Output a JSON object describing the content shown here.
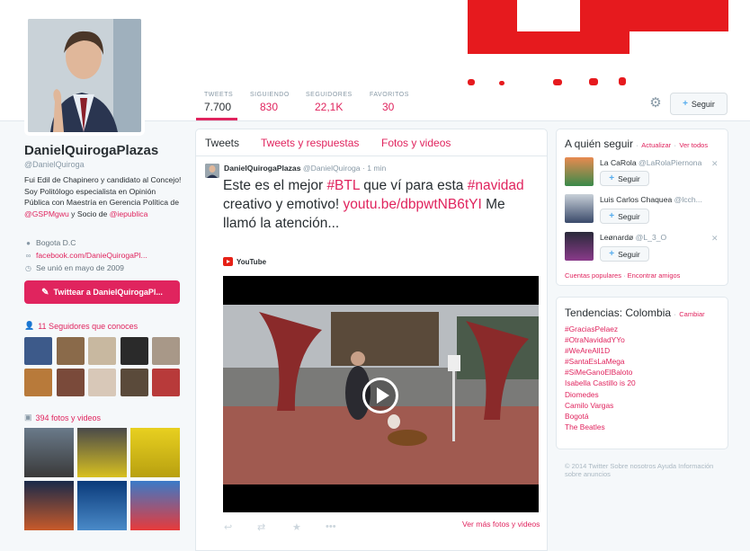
{
  "profile": {
    "name": "DanielQuirogaPlazas",
    "handle": "@DanielQuiroga",
    "bio_part1": "Fui Edil de Chapinero y candidato al Concejo! Soy Politólogo especialista en Opinión Pública con Maestría en Gerencia Política de ",
    "bio_mention1": "@GSPMgwu",
    "bio_part2": " y Socio de ",
    "bio_mention2": "@iepublica",
    "location": "Bogota D.C",
    "website": "facebook.com/DanieQuirogaPl...",
    "joined": "Se unió en mayo de 2009",
    "tweet_to_label": "Twittear a DanielQuirogaPl...",
    "followers_you_know": "11 Seguidores que conoces",
    "photos_videos": "394 fotos y videos"
  },
  "stats": [
    {
      "label": "TWEETS",
      "value": "7.700"
    },
    {
      "label": "SIGUIENDO",
      "value": "830"
    },
    {
      "label": "SEGUIDORES",
      "value": "22,1K"
    },
    {
      "label": "FAVORITOS",
      "value": "30"
    }
  ],
  "header": {
    "follow_label": "Seguir"
  },
  "timeline": {
    "tabs": [
      "Tweets",
      "Tweets y respuestas",
      "Fotos y videos"
    ],
    "tweet": {
      "name": "DanielQuirogaPlazas",
      "handle": "@DanielQuiroga",
      "separator": "·",
      "time": "1 min",
      "text_part1": "Este es el mejor ",
      "hashtag1": "#BTL",
      "text_part2": " que ví para esta ",
      "hashtag2": "#navidad",
      "text_part3": " creativo y emotivo! ",
      "link": "youtu.be/dbpwtNB6tYI",
      "text_part4": "  Me llamó la atención...",
      "source": "YouTube"
    },
    "more_media": "Ver más fotos y videos"
  },
  "who_to_follow": {
    "title": "A quién seguir",
    "separator": "·",
    "refresh": "Actualizar",
    "view_all": "Ver todos",
    "follow_label": "Seguir",
    "users": [
      {
        "name": "La CaRola",
        "handle": "@LaRolaPiernona"
      },
      {
        "name": "Luis Carlos Chaquea",
        "handle": "@lcch..."
      },
      {
        "name": "Leønardø",
        "handle": "@L_3_O"
      }
    ],
    "popular": "Cuentas populares",
    "find_friends": "Encontrar amigos"
  },
  "trends": {
    "title": "Tendencias: Colombia",
    "separator": "·",
    "change": "Cambiar",
    "items": [
      "#GraciasPelaez",
      "#OtraNavidadYYo",
      "#WeAreAll1D",
      "#SantaEsLaMega",
      "#SiMeGanoElBaloto",
      "Isabella Castillo is 20",
      "Diomedes",
      "Camilo Vargas",
      "Bogotá",
      "The Beatles"
    ]
  },
  "footer": {
    "text": "© 2014 Twitter   Sobre nosotros   Ayuda   Información sobre anuncios"
  },
  "colors": {
    "accent": "#e0245e",
    "banner_red": "#e61a1e",
    "follow_blue": "#55acee"
  }
}
